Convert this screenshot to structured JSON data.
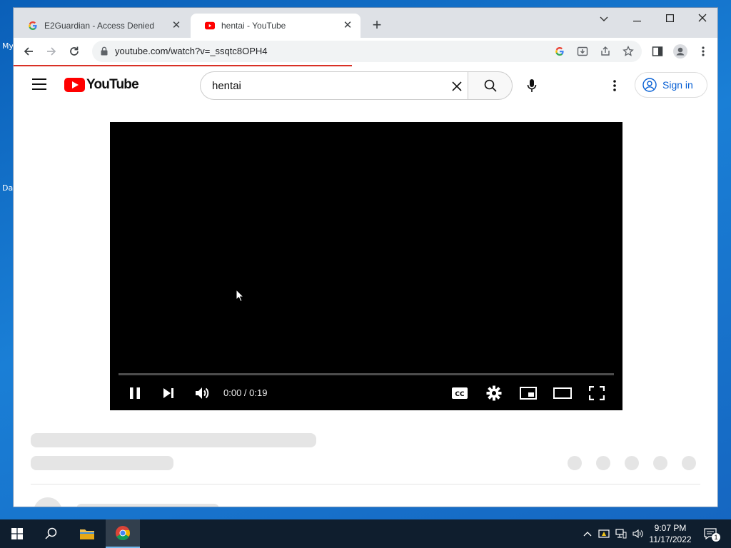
{
  "desktop": {
    "icon_label_1": "My",
    "icon_label_2": "Da"
  },
  "browser": {
    "tabs": [
      {
        "title": "E2Guardian - Access Denied",
        "favicon": "google-g-icon",
        "active": false
      },
      {
        "title": "hentai - YouTube",
        "favicon": "youtube-icon",
        "active": true
      }
    ],
    "url": "youtube.com/watch?v=_ssqtc8OPH4",
    "load_progress": 0.48
  },
  "youtube": {
    "logo_text": "YouTube",
    "search_query": "hentai",
    "signin_label": "Sign in",
    "player": {
      "time_display": "0:00 / 0:19",
      "played_fraction": 0.0
    }
  },
  "taskbar": {
    "time": "9:07 PM",
    "date": "11/17/2022",
    "notification_count": "1"
  },
  "colors": {
    "youtube_red": "#ff0000",
    "link_blue": "#065fd4",
    "loading_red": "#d93025"
  }
}
